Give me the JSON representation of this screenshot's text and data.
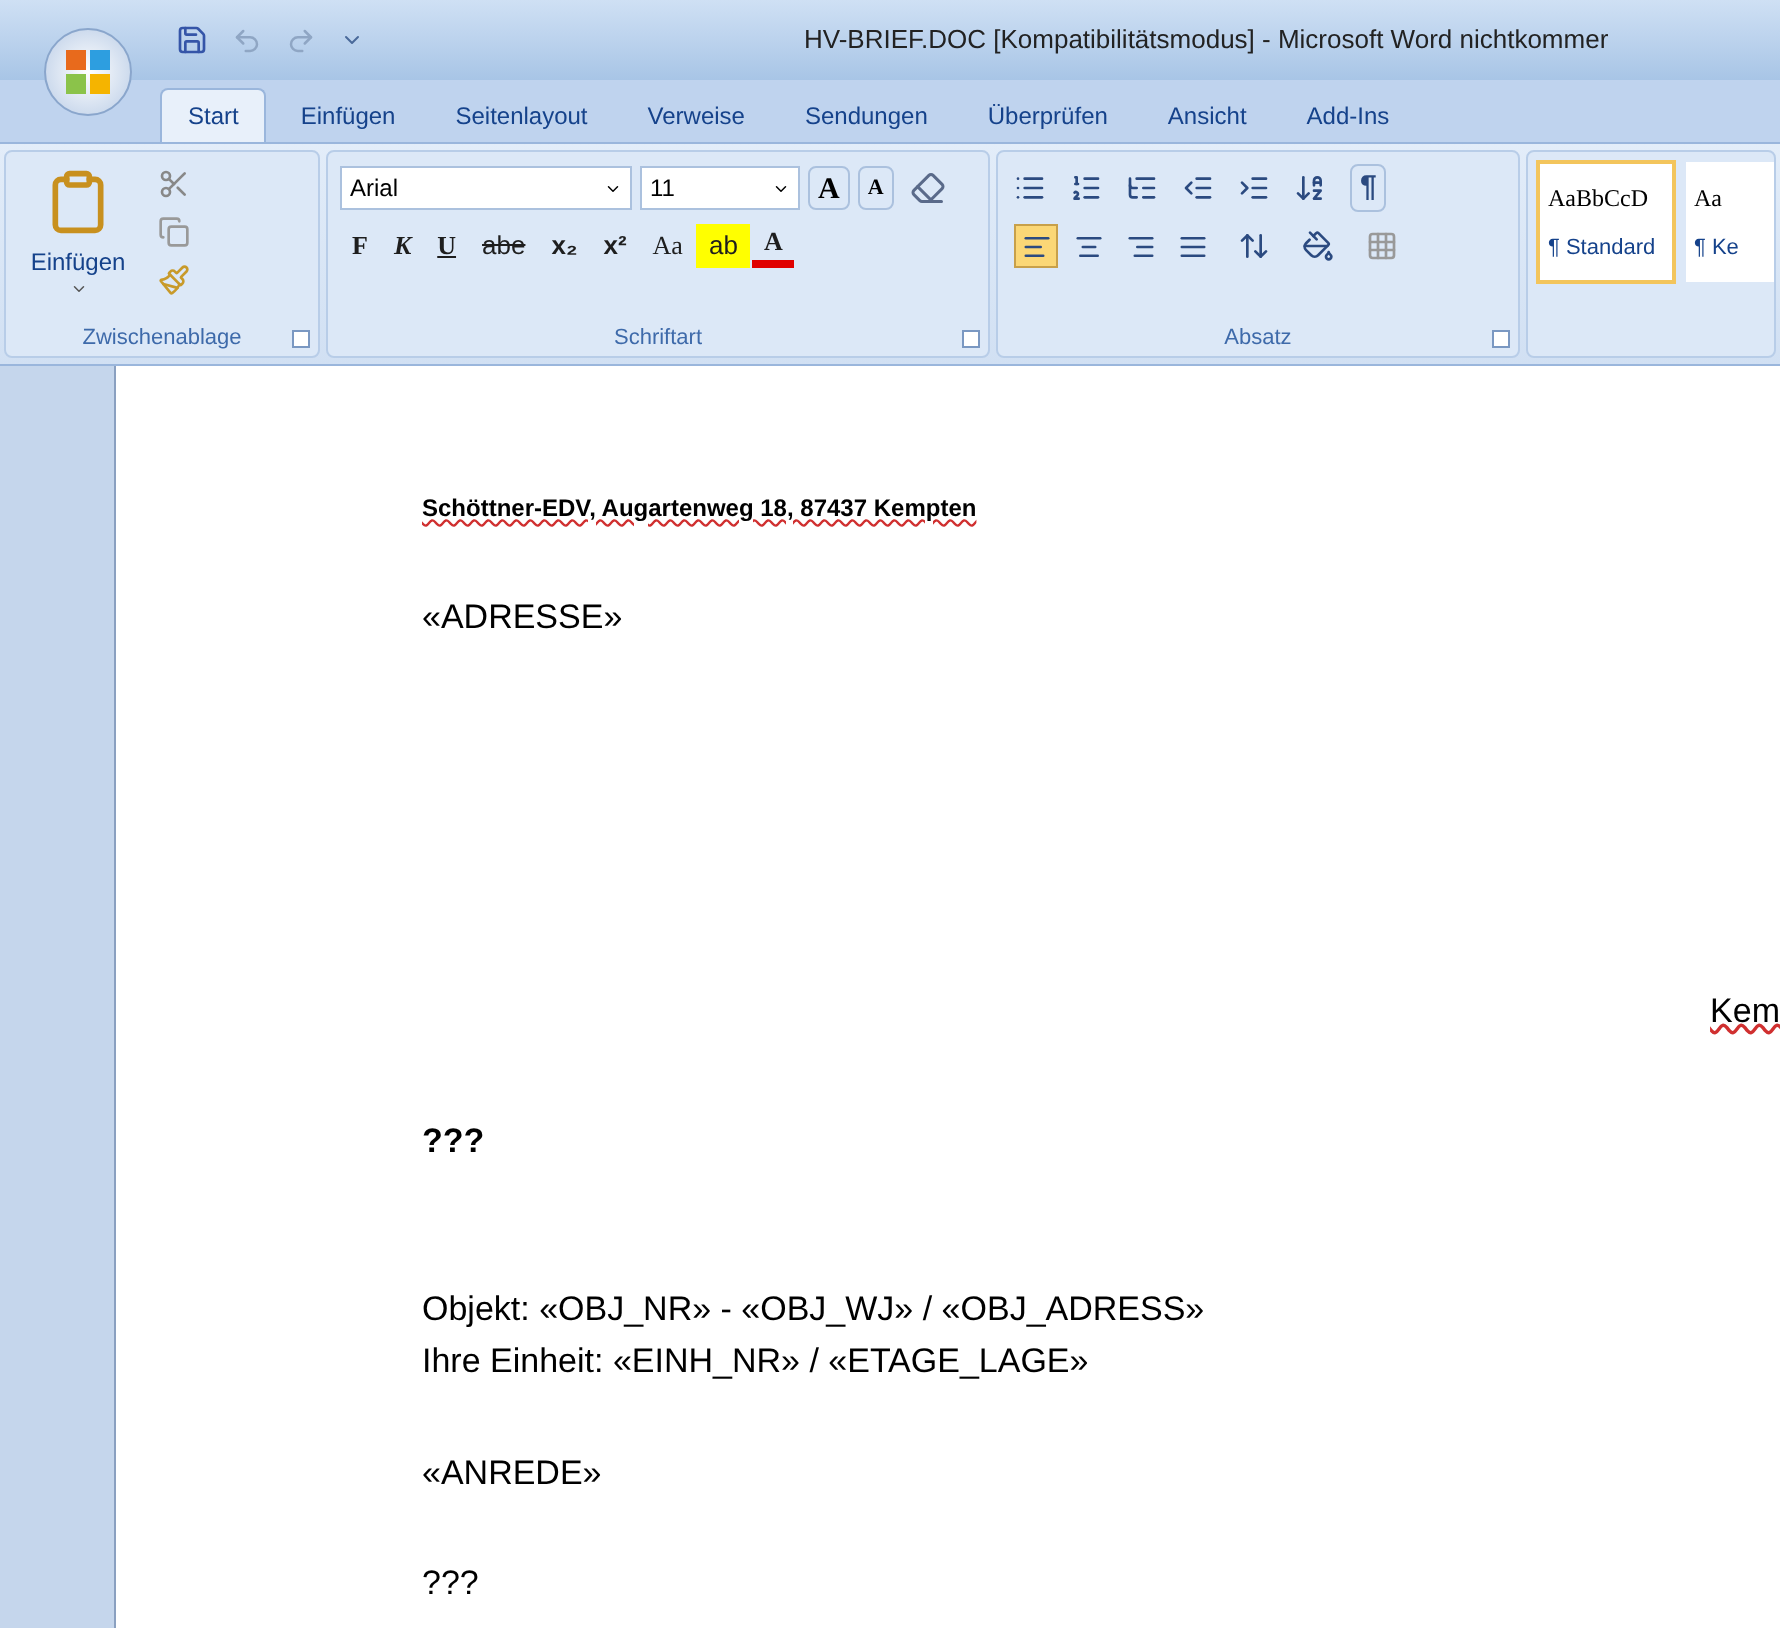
{
  "window": {
    "title": "HV-BRIEF.DOC [Kompatibilitätsmodus] - Microsoft Word nichtkommer"
  },
  "tabs": [
    {
      "label": "Start",
      "selected": true
    },
    {
      "label": "Einfügen",
      "selected": false
    },
    {
      "label": "Seitenlayout",
      "selected": false
    },
    {
      "label": "Verweise",
      "selected": false
    },
    {
      "label": "Sendungen",
      "selected": false
    },
    {
      "label": "Überprüfen",
      "selected": false
    },
    {
      "label": "Ansicht",
      "selected": false
    },
    {
      "label": "Add-Ins",
      "selected": false
    }
  ],
  "clipboard": {
    "paste_label": "Einfügen",
    "group_label": "Zwischenablage"
  },
  "font": {
    "family": "Arial",
    "size": "11",
    "grow": "A",
    "shrink": "A",
    "group_label": "Schriftart",
    "format_buttons": [
      {
        "label": "F",
        "kind": "bold"
      },
      {
        "label": "K",
        "kind": "italic"
      },
      {
        "label": "U",
        "kind": "underline"
      },
      {
        "label": "abe",
        "kind": "strike"
      },
      {
        "label": "x₂",
        "kind": "plain"
      },
      {
        "label": "x²",
        "kind": "plain"
      },
      {
        "label": "Aa",
        "kind": "serif"
      },
      {
        "label": "ab",
        "kind": "highlight"
      },
      {
        "label": "A",
        "kind": "fontcolor"
      }
    ]
  },
  "paragraph": {
    "group_label": "Absatz",
    "alignment": [
      {
        "kind": "left",
        "selected": true
      },
      {
        "kind": "center",
        "selected": false
      },
      {
        "kind": "right",
        "selected": false
      },
      {
        "kind": "justify",
        "selected": false
      }
    ],
    "show_marks": "¶"
  },
  "styles": [
    {
      "preview": "AaBbCcD",
      "label": "¶ Standard",
      "selected": true
    },
    {
      "preview": "Aa",
      "label": "¶ Ke",
      "selected": false
    }
  ],
  "document": {
    "sender_line": "Schöttner-EDV, Augartenweg 18, 87437 Kempten",
    "address": "«ADRESSE»",
    "place": "Kem",
    "subject": "???",
    "object_lines": [
      "Objekt: «OBJ_NR» - «OBJ_WJ» / «OBJ_ADRESS»",
      "Ihre Einheit: «EINH_NR» / «ETAGE_LAGE»"
    ],
    "salutation": "«ANREDE»",
    "body": "???"
  }
}
